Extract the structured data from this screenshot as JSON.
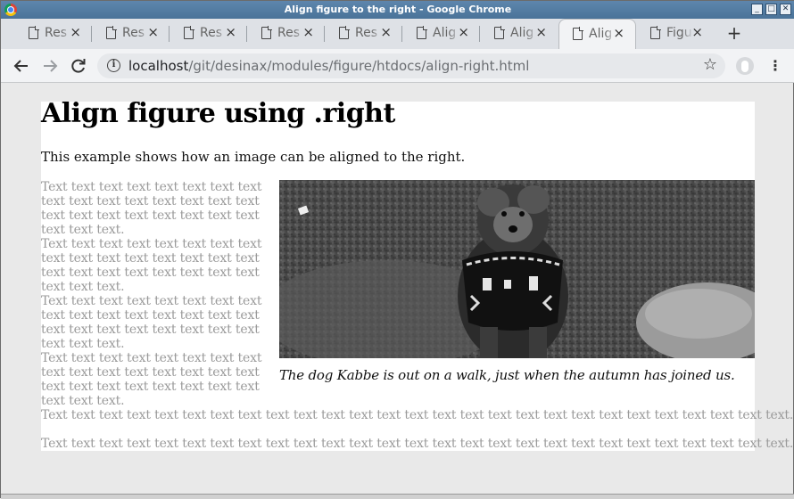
{
  "window": {
    "title": "Align figure to the right - Google Chrome",
    "controls": [
      "minimize",
      "maximize",
      "close"
    ]
  },
  "tabs": [
    {
      "label": "Res",
      "active": false
    },
    {
      "label": "Res",
      "active": false
    },
    {
      "label": "Res",
      "active": false
    },
    {
      "label": "Res",
      "active": false
    },
    {
      "label": "Res",
      "active": false
    },
    {
      "label": "Alig",
      "active": false
    },
    {
      "label": "Alig",
      "active": false
    },
    {
      "label": "Alig",
      "active": true
    },
    {
      "label": "Figu",
      "active": false
    }
  ],
  "new_tab_label": "+",
  "toolbar": {
    "back_icon": "arrow-left-icon",
    "forward_icon": "arrow-right-icon",
    "reload_icon": "reload-icon",
    "url_host": "localhost",
    "url_path": "/git/desinax/modules/figure/htdocs/align-right.html",
    "star_icon": "star-icon",
    "menu_icon": "kebab-menu-icon"
  },
  "page": {
    "heading": "Align figure using .right",
    "intro": "This example shows how an image can be aligned to the right.",
    "paragraphs_narrow": [
      "Text text text text text text text text text text text text text text text text text text text text text text text text text text text.",
      "Text text text text text text text text text text text text text text text text text text text text text text text text text text text.",
      "Text text text text text text text text text text text text text text text text text text text text text text text text text text text.",
      "Text text text text text text text text text text text text text text text text text text text text text text text text text text text."
    ],
    "paragraphs_wide": [
      "Text text text text text text text text text text text text text text text text text text text text text text text text text text text.",
      "Text text text text text text text text text text text text text text text text text text text text text text text text text text text."
    ],
    "figure": {
      "image_alt": "Black and white photo of a curly dog wearing a patterned harness",
      "caption": "The dog Kabbe is out on a walk, just when the autumn has joined us."
    }
  }
}
